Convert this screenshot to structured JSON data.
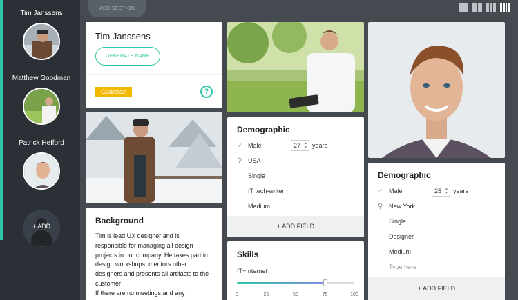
{
  "sidebar": {
    "personas": [
      {
        "name": "Tim Janssens"
      },
      {
        "name": "Matthew Goodman"
      },
      {
        "name": "Patrick Hefford"
      }
    ],
    "add_label": "+ ADD"
  },
  "toolbar": {
    "add_section_label": "ADD SECTION",
    "layout_options": [
      "layout-1-column",
      "layout-2-columns",
      "layout-3-columns",
      "layout-4-columns"
    ]
  },
  "profile_card": {
    "name": "Tim Janssens",
    "generate_label": "GENERATE NAME",
    "tag": "Guardian",
    "help_symbol": "?"
  },
  "background_card": {
    "title": "Background",
    "text": "Tim is lead UX designer and is responsible for managing all design projects in our company. He takes part in design workshops, mentors other designers and presents all artifacts to the customer\nIf there are no meetings and any"
  },
  "demographic_left": {
    "title": "Demographic",
    "gender": "Male",
    "age": "27",
    "age_unit": "years",
    "location": "USA",
    "status": "Single",
    "occupation": "IT tech-writer",
    "level": "Medium",
    "add_field_label": "+ ADD FIELD"
  },
  "skills_card": {
    "title": "Skills",
    "skill": "IT+Internet",
    "level_percent": 75,
    "ticks": [
      "0",
      "25",
      "50",
      "75",
      "100"
    ]
  },
  "demographic_right": {
    "title": "Demographic",
    "gender": "Male",
    "age": "25",
    "age_unit": "years",
    "location": "New York",
    "status": "Single",
    "occupation": "Designer",
    "level": "Medium",
    "placeholder": "Type here",
    "add_field_label": "+ ADD FIELD"
  },
  "colors": {
    "accent": "#2ec4a7",
    "sidebar": "#2b3036",
    "canvas": "#454a51",
    "tag": "#f5b800"
  }
}
